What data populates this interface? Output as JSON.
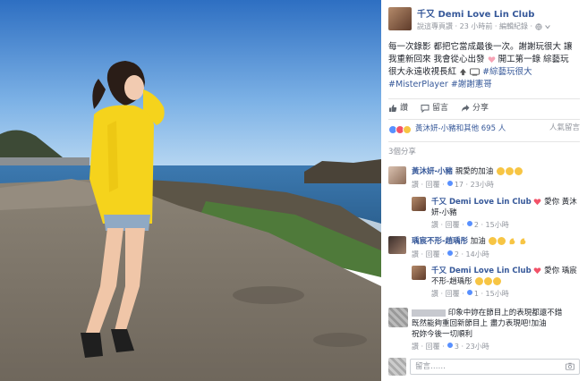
{
  "post": {
    "page_name": "千又 Demi Love Lin Club",
    "meta": "說這專頁讚 · 23 小時前 · 編輯紀錄 · ",
    "text_line1": "每一次錄影 都把它當成最後一次。謝謝玩很大 讓",
    "text_line2": "我重新回來 我會從心出發",
    "text_line2b": "開工第一錄 綜藝玩",
    "text_line3": "很大永遠收視長紅",
    "text_line3_tag": "#綜藝玩很大",
    "text_line4_tag1": "#MisterPlayer",
    "text_line4_tag2": "#謝謝憲哥"
  },
  "actions": {
    "like": "讚",
    "comment": "留言",
    "share": "分享"
  },
  "reactions": {
    "summary": "黃沐妍-小豬和其他 695 人",
    "right": "人氣留言"
  },
  "shares": "3個分享",
  "comments": [
    {
      "author": "黃沐妍-小豬",
      "text": "親愛的加油",
      "acts": "讚 · 回覆 · ",
      "likes": "17",
      "time": "23小時"
    },
    {
      "author": "千又 Demi Love Lin Club",
      "text": "愛你 黃沐",
      "text2": "妍-小豬",
      "acts": "讚 · 回覆 · ",
      "likes": "2",
      "time": "15小時"
    },
    {
      "author": "瑀宸不形-趙瑀彤",
      "text": "加油",
      "acts": "讚 · 回覆 · ",
      "likes": "2",
      "time": "14小時"
    },
    {
      "author": "千又 Demi Love Lin Club",
      "text": "愛你 瑀宸",
      "text2": "不形-趙瑀彤",
      "acts": "讚 · 回覆 · ",
      "likes": "1",
      "time": "15小時"
    },
    {
      "text": "印象中妳在節目上的表現都還不錯",
      "text2": "既然能夠重回新節目上 盡力表現吧!加油",
      "text3": "祝妳今後一切順利",
      "acts": "讚 · 回覆 · ",
      "likes": "3",
      "time": "23小時"
    }
  ],
  "write": {
    "placeholder": "留言……"
  },
  "colors": {
    "link": "#365899",
    "muted": "#90949c",
    "like_blue": "#5890ff",
    "heart_red": "#f25268",
    "hoodie": "#f5d31c"
  }
}
